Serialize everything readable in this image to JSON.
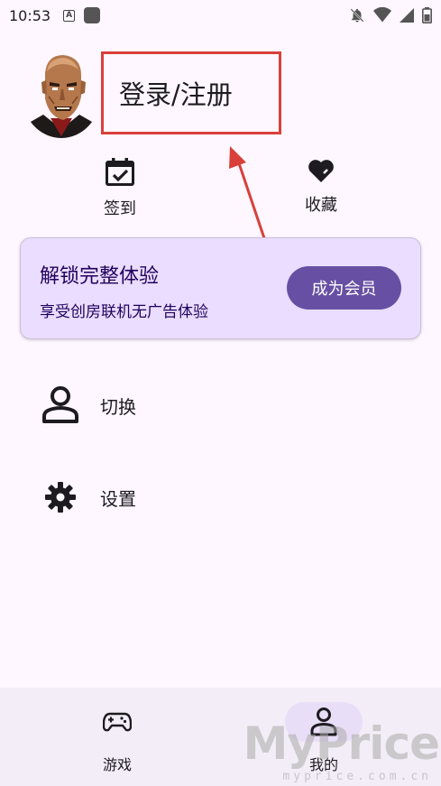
{
  "status_bar": {
    "time": "10:53",
    "indicator_letter": "A"
  },
  "profile": {
    "login_label": "登录/注册"
  },
  "quick_actions": [
    {
      "label": "签到",
      "icon": "calendar-check-icon"
    },
    {
      "label": "收藏",
      "icon": "heart-icon"
    }
  ],
  "member_card": {
    "title": "解锁完整体验",
    "subtitle": "享受创房联机无广告体验",
    "button_label": "成为会员"
  },
  "menu": [
    {
      "label": "切换",
      "icon": "person-icon"
    },
    {
      "label": "设置",
      "icon": "gear-icon"
    }
  ],
  "bottom_nav": [
    {
      "label": "游戏",
      "icon": "gamepad-icon",
      "active": false
    },
    {
      "label": "我的",
      "icon": "person-icon",
      "active": true
    }
  ],
  "watermark": {
    "brand": "MyPrice",
    "domain": "myprice.com.cn"
  },
  "colors": {
    "background": "#fef7ff",
    "card": "#eaddff",
    "primary": "#6750a4",
    "highlight_box": "#d9403a",
    "nav_bar": "#f3edf7"
  }
}
